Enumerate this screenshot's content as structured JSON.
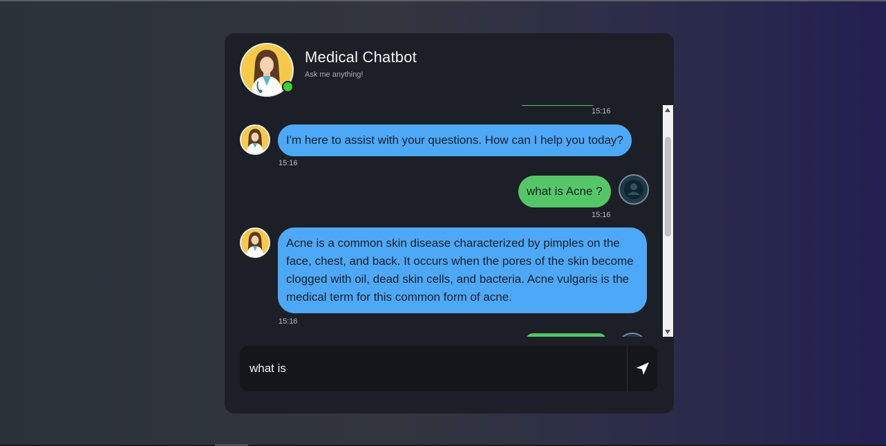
{
  "header": {
    "title": "Medical Chatbot",
    "subtitle": "Ask me anything!",
    "status_color": "#3ed034"
  },
  "messages": [
    {
      "sender": "user",
      "text": "",
      "time": "15:16"
    },
    {
      "sender": "bot",
      "text": "I'm here to assist with your questions. How can I help you today?",
      "time": "15:16"
    },
    {
      "sender": "user",
      "text": "what is Acne ?",
      "time": "15:16"
    },
    {
      "sender": "bot",
      "text": "Acne is a common skin disease characterized by pimples on the face, chest, and back. It occurs when the pores of the skin become clogged with oil, dead skin cells, and bacteria. Acne vulgaris is the medical term for this common form of acne.",
      "time": "15:16"
    }
  ],
  "input": {
    "value": "what is"
  },
  "icons": {
    "send": "send-icon",
    "bot_avatar": "doctor-avatar-icon",
    "user_avatar": "user-avatar-icon"
  },
  "colors": {
    "bot_bubble": "#4ea8f8",
    "user_bubble": "#55c668",
    "card_bg": "#1c1f26"
  }
}
